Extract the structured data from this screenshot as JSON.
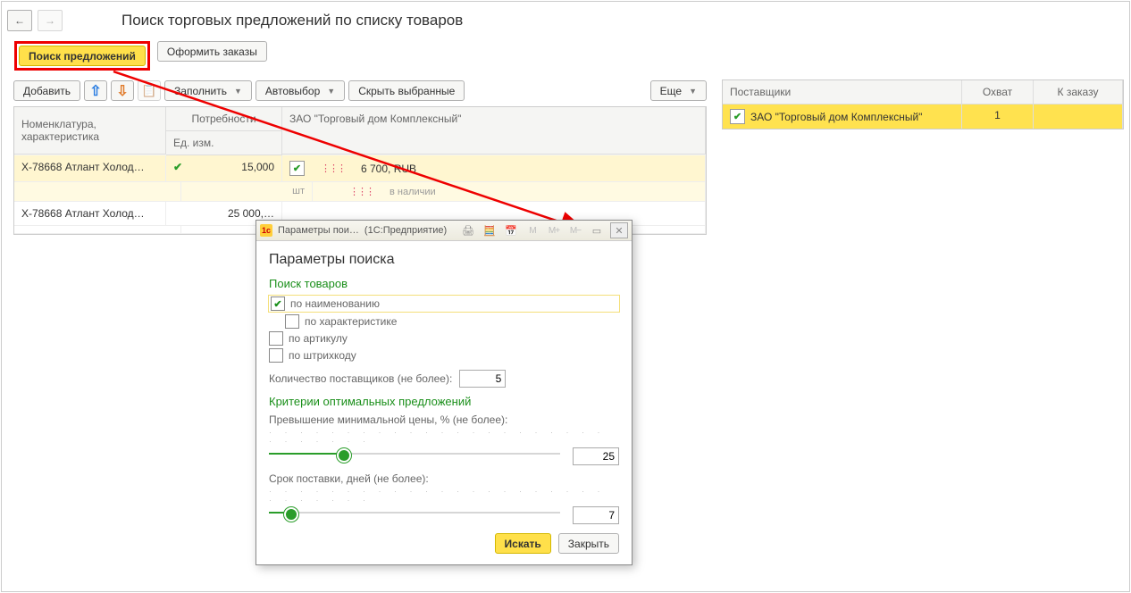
{
  "header": {
    "title": "Поиск торговых предложений по списку товаров"
  },
  "main_buttons": {
    "search_offers": "Поиск предложений",
    "make_orders": "Оформить заказы"
  },
  "toolbar": {
    "add": "Добавить",
    "fill": "Заполнить",
    "auto_select": "Автовыбор",
    "hide_selected": "Скрыть выбранные",
    "more": "Еще"
  },
  "left_table": {
    "headers": {
      "nomenclature": "Номенклатура, характеристика",
      "needs": "Потребности",
      "supplier": "ЗАО \"Торговый дом Комплексный\"",
      "units": "Ед. изм."
    },
    "rows": [
      {
        "name": "X-78668 Атлант Холод…",
        "qty": "15,000",
        "unit": "шт",
        "price": "6 700, RUB",
        "avail": "в наличии",
        "selected": true,
        "checked": true
      },
      {
        "name": "X-78668 Атлант Холод…",
        "qty": "25 000,…",
        "unit": "",
        "price": "",
        "avail": "",
        "selected": false,
        "checked": false
      }
    ]
  },
  "right_table": {
    "headers": {
      "suppliers": "Поставщики",
      "coverage": "Охват",
      "to_order": "К заказу"
    },
    "row": {
      "name": "ЗАО \"Торговый дом Комплексный\"",
      "coverage": "1"
    }
  },
  "dialog": {
    "window_title_short": "Параметры пои…",
    "window_title_app": "(1С:Предприятие)",
    "heading": "Параметры поиска",
    "section_search": "Поиск товаров",
    "chk_by_name": "по наименованию",
    "chk_by_characteristic": "по характеристике",
    "chk_by_article": "по артикулу",
    "chk_by_barcode": "по штрихкоду",
    "suppliers_count_label": "Количество поставщиков (не более):",
    "suppliers_count_value": "5",
    "section_criteria": "Критерии оптимальных предложений",
    "price_excess_label": "Превышение минимальной цены, % (не более):",
    "price_excess_value": "25",
    "delivery_days_label": "Срок поставки, дней (не более):",
    "delivery_days_value": "7",
    "btn_search": "Искать",
    "btn_close": "Закрыть"
  }
}
